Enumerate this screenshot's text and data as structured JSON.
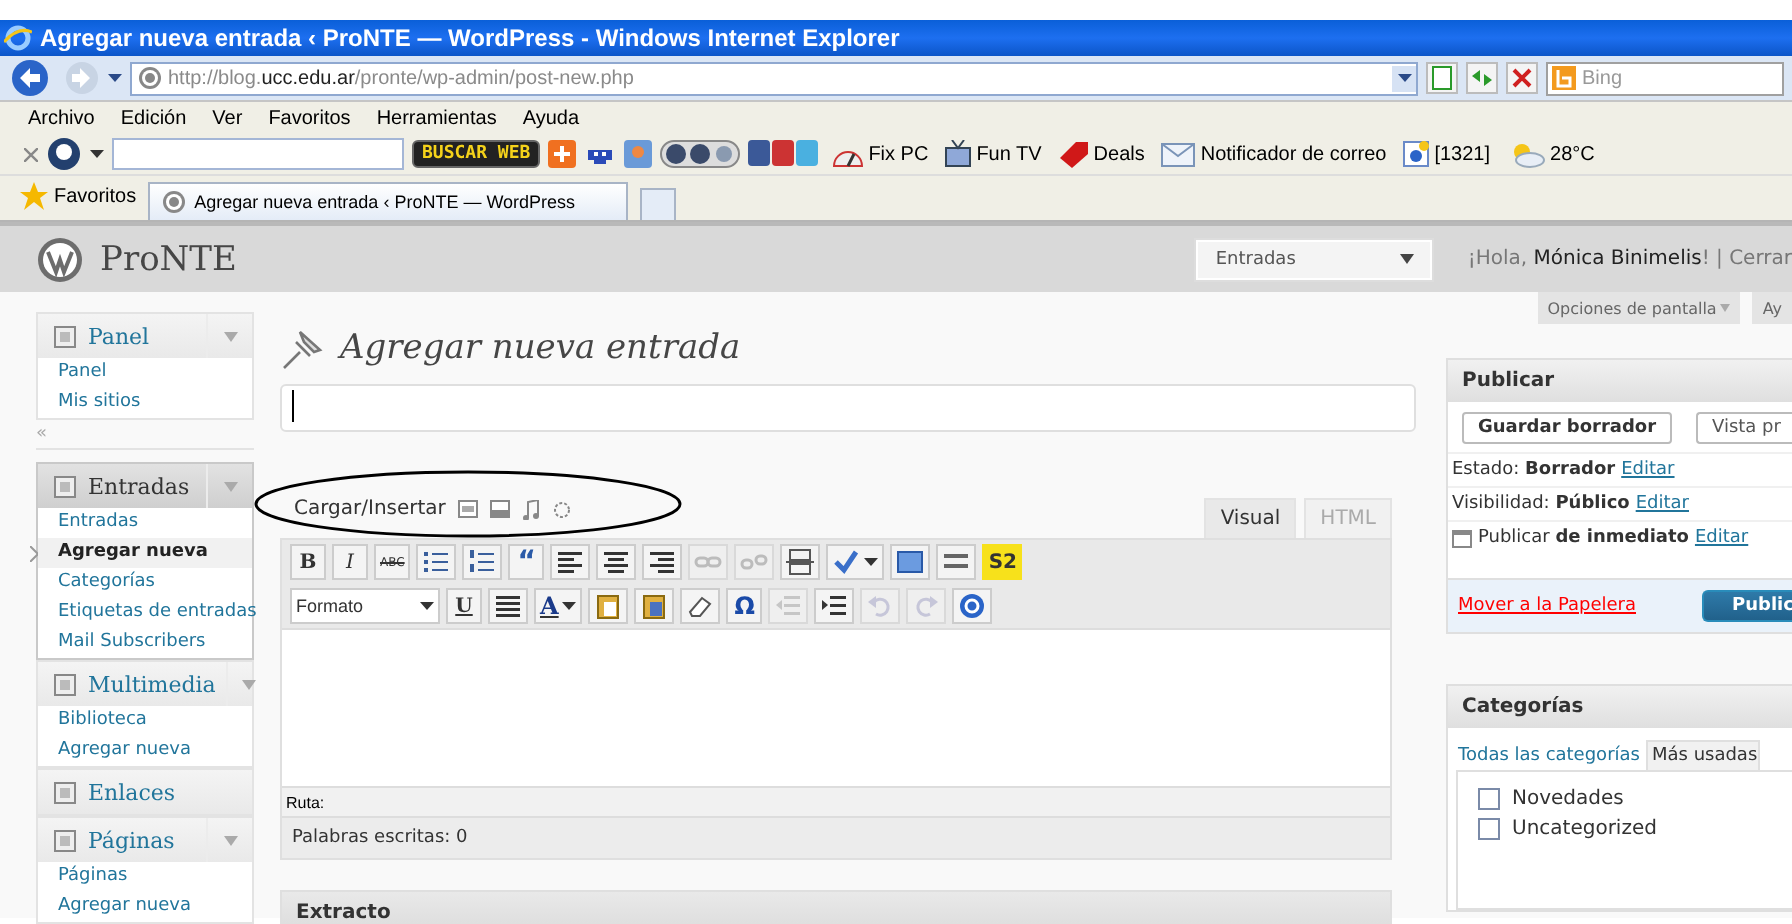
{
  "window": {
    "title": "Agregar nueva entrada ‹ ProNTE — WordPress - Windows Internet Explorer"
  },
  "address_bar": {
    "url": "http://blog.**ucc.edu.ar**/pronte/wp-admin/post-new.php",
    "search_placeholder": "Bing"
  },
  "menu_bar": [
    "Archivo",
    "Edición",
    "Ver",
    "Favoritos",
    "Herramientas",
    "Ayuda"
  ],
  "toolbar": {
    "search_button": "BUSCAR WEB",
    "items": [
      {
        "kind": "gauge",
        "label": "Fix PC"
      },
      {
        "kind": "tv",
        "label": "Fun TV"
      },
      {
        "kind": "tag",
        "label": "Deals"
      },
      {
        "kind": "mail",
        "label": "Notificador de correo"
      },
      {
        "kind": "counter",
        "label": "[1321]"
      },
      {
        "kind": "weather",
        "label": "28°C"
      }
    ]
  },
  "favorites_bar": {
    "label": "Favoritos",
    "tabs": [
      {
        "label": "Agregar nueva entrada ‹ ProNTE — WordPress",
        "selected": true
      }
    ]
  },
  "wp_header": {
    "site": "ProNTE",
    "dropdown": "Entradas",
    "greeting": "¡Hola, **Mónica Binimelis**! | Cerrar"
  },
  "screen_tabs": [
    "Opciones de pantalla",
    "Ay"
  ],
  "sidebar": [
    {
      "kind": "group",
      "label": "Panel",
      "current": false,
      "has_toggle": true,
      "items": [
        {
          "label": "Panel",
          "selected": false
        },
        {
          "label": "Mis sitios",
          "selected": false
        }
      ]
    },
    {
      "kind": "separator",
      "label": "«"
    },
    {
      "kind": "group",
      "label": "Entradas",
      "current": true,
      "has_toggle": true,
      "items": [
        {
          "label": "Entradas",
          "selected": false
        },
        {
          "label": "Agregar nueva",
          "selected": true
        },
        {
          "label": "Categorías",
          "selected": false
        },
        {
          "label": "Etiquetas de entradas",
          "selected": false
        },
        {
          "label": "Mail Subscribers",
          "selected": false
        }
      ]
    },
    {
      "kind": "group",
      "label": "Multimedia",
      "current": false,
      "has_toggle": true,
      "items": [
        {
          "label": "Biblioteca",
          "selected": false
        },
        {
          "label": "Agregar nueva",
          "selected": false
        }
      ]
    },
    {
      "kind": "group",
      "label": "Enlaces",
      "current": false,
      "has_toggle": false
    },
    {
      "kind": "group",
      "label": "Páginas",
      "current": false,
      "has_toggle": true,
      "items": [
        {
          "label": "Páginas",
          "selected": false
        },
        {
          "label": "Agregar nueva",
          "selected": false
        }
      ]
    }
  ],
  "page_title": "Agregar nueva entrada",
  "editor": {
    "upload_label": "Cargar/Insertar",
    "tabs": [
      {
        "label": "Visual",
        "selected": true
      },
      {
        "label": "HTML",
        "selected": false
      }
    ],
    "toolbar_rows": [
      [
        {
          "kind": "bold",
          "label": "B"
        },
        {
          "kind": "italic",
          "label": "I"
        },
        {
          "kind": "strike",
          "label": "ABC"
        },
        {
          "kind": "bullets"
        },
        {
          "kind": "numbers"
        },
        {
          "kind": "quote",
          "label": "“"
        },
        {
          "kind": "align-left"
        },
        {
          "kind": "align-center"
        },
        {
          "kind": "align-right"
        },
        {
          "kind": "link",
          "disabled": true
        },
        {
          "kind": "unlink",
          "disabled": true
        },
        {
          "kind": "more"
        },
        {
          "kind": "spell"
        },
        {
          "kind": "fullscreen"
        },
        {
          "kind": "kitchen"
        },
        {
          "kind": "badge",
          "label": "S2"
        }
      ],
      [
        {
          "kind": "select",
          "label": "Formato"
        },
        {
          "kind": "underline",
          "label": "U"
        },
        {
          "kind": "justify"
        },
        {
          "kind": "color",
          "label": "A"
        },
        {
          "kind": "paste-text"
        },
        {
          "kind": "paste-word"
        },
        {
          "kind": "eraser"
        },
        {
          "kind": "symbol",
          "label": "Ω"
        },
        {
          "kind": "outdent",
          "disabled": true
        },
        {
          "kind": "indent"
        },
        {
          "kind": "undo",
          "disabled": true
        },
        {
          "kind": "redo",
          "disabled": true
        },
        {
          "kind": "help"
        }
      ]
    ],
    "path_label": "Ruta:",
    "word_count": "Palabras escritas: 0"
  },
  "excerpt": {
    "title": "Extracto"
  },
  "publish": {
    "title": "Publicar",
    "buttons": [
      "Guardar borrador",
      "Vista pr"
    ],
    "rows": [
      {
        "kind": "plain",
        "text": "Estado: **Borrador**",
        "link": "Editar"
      },
      {
        "kind": "plain",
        "text": "Visibilidad: **Público**",
        "link": "Editar"
      },
      {
        "kind": "calendar",
        "text": "Publicar **de inmediato**",
        "link": "Editar"
      }
    ],
    "trash_link": "Mover a la Papelera",
    "publish_button": "Public"
  },
  "categories": {
    "title": "Categorías",
    "tabs": [
      {
        "label": "Todas las categorías",
        "selected": false
      },
      {
        "label": "Más usadas",
        "selected": true
      }
    ],
    "items": [
      {
        "label": "Novedades",
        "checked": false
      },
      {
        "label": "Uncategorized",
        "checked": false
      }
    ]
  }
}
